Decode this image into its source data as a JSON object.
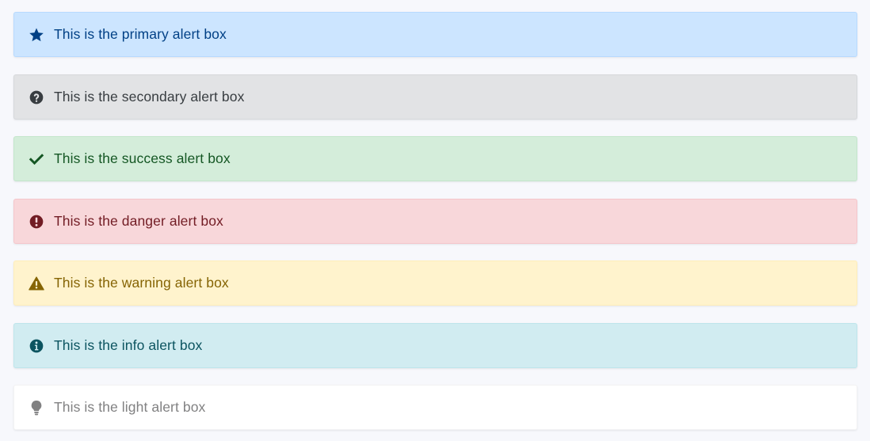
{
  "alerts": [
    {
      "variant": "primary",
      "text": "This is the primary alert box",
      "icon": "star-icon",
      "bg": "#cce5ff",
      "border": "#b8daff",
      "color": "#004085"
    },
    {
      "variant": "secondary",
      "text": "This is the secondary alert box",
      "icon": "question-circle-icon",
      "bg": "#e2e3e5",
      "border": "#d6d8db",
      "color": "#383d41"
    },
    {
      "variant": "success",
      "text": "This is the success alert box",
      "icon": "check-icon",
      "bg": "#d4edda",
      "border": "#c3e6cb",
      "color": "#155724"
    },
    {
      "variant": "danger",
      "text": "This is the danger alert box",
      "icon": "exclamation-circle-icon",
      "bg": "#f8d7da",
      "border": "#f5c6cb",
      "color": "#721c24"
    },
    {
      "variant": "warning",
      "text": "This is the warning alert box",
      "icon": "warning-triangle-icon",
      "bg": "#fff3cd",
      "border": "#ffeeba",
      "color": "#856404"
    },
    {
      "variant": "info",
      "text": "This is the info alert box",
      "icon": "info-circle-icon",
      "bg": "#d1ecf1",
      "border": "#bee5eb",
      "color": "#0c5460"
    },
    {
      "variant": "light",
      "text": "This is the light alert box",
      "icon": "lightbulb-icon",
      "bg": "#ffffff",
      "border": "#f3f3f4",
      "color": "#818182"
    }
  ]
}
